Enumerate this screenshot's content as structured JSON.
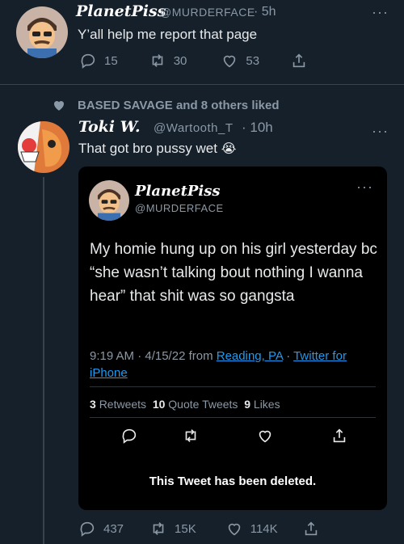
{
  "tweet1": {
    "display_name": "PlanetPiss",
    "handle": "@MURDERFACE",
    "time": "· 5h",
    "text": "Y’all help me report that page",
    "replies": "15",
    "retweets": "30",
    "likes": "53"
  },
  "social_context": {
    "text": "BASED SAVAGE and 8 others liked"
  },
  "tweet2": {
    "display_name": "Toki W.",
    "handle": "@Wartooth_T",
    "time": "· 10h",
    "text": "That got bro pussy wet",
    "emoji": "😭",
    "replies": "437",
    "retweets": "15K",
    "likes": "114K"
  },
  "embedded": {
    "display_name": "PlanetPiss",
    "handle": "@MURDERFACE",
    "text": "My homie hung up on his girl yesterday bc “she wasn’t talking bout nothing I wanna hear” that shit was so gangsta",
    "timestamp": "9:19 AM · 4/15/22 from ",
    "location": "Reading, PA",
    "dot": " · ",
    "source": "Twitter for iPhone",
    "retweets_count": "3",
    "retweets_label": "Retweets",
    "quotes_count": "10",
    "quotes_label": "Quote Tweets",
    "likes_count": "9",
    "likes_label": "Likes",
    "deleted_notice": "This Tweet has been deleted."
  },
  "colors": {
    "background": "#15202b",
    "card": "#000000",
    "link": "#1d9bf0",
    "muted": "#8b98a5"
  }
}
